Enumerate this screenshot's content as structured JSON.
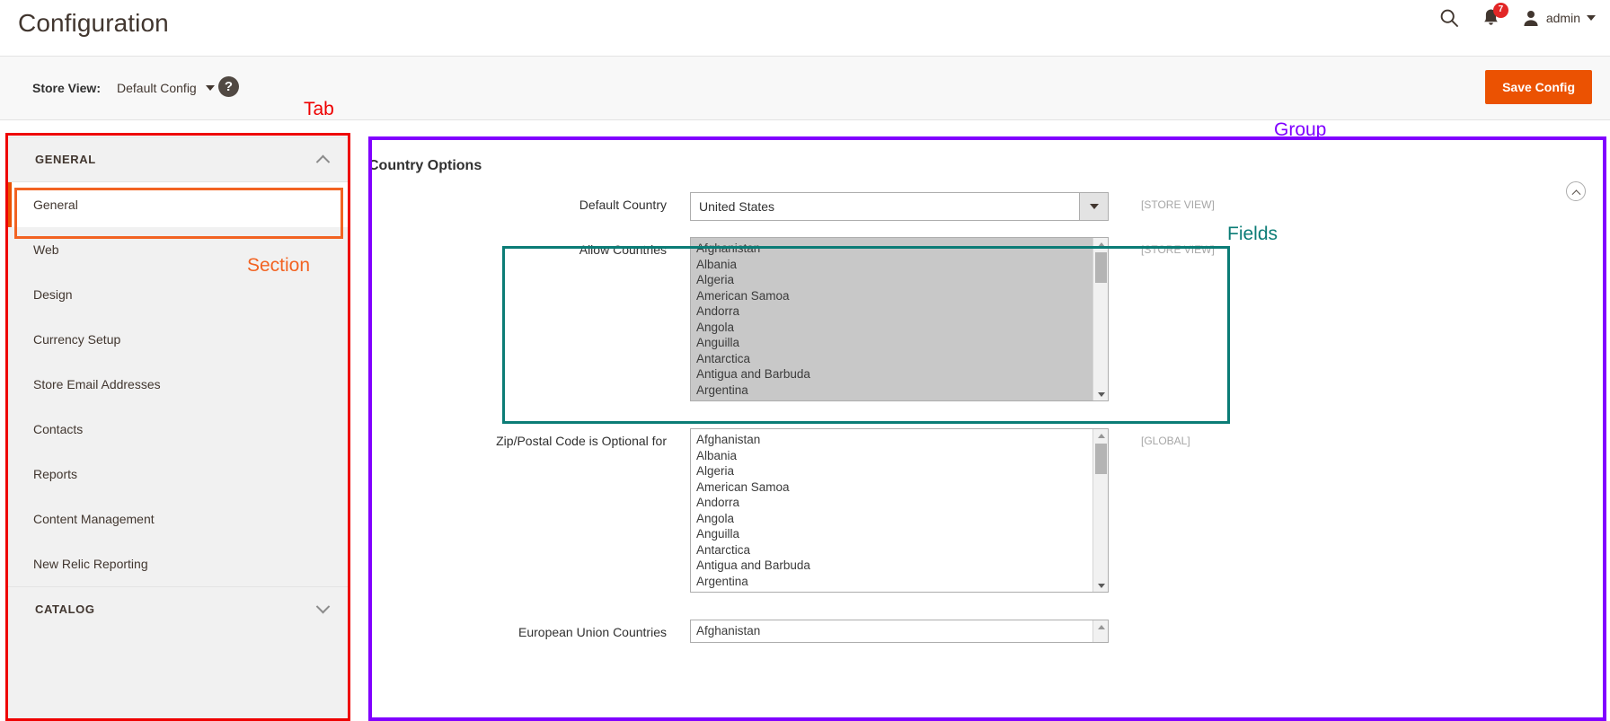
{
  "header": {
    "title": "Configuration",
    "search_icon": "search-icon",
    "notifications_icon": "bell-icon",
    "notifications_count": "7",
    "user_icon": "user-avatar-icon",
    "user_name": "admin",
    "caret_icon": "chevron-down-icon"
  },
  "switcher": {
    "label": "Store View:",
    "value": "Default Config",
    "caret_icon": "chevron-down-icon",
    "help_icon": "?",
    "save_label": "Save Config",
    "accent_color": "#eb5202"
  },
  "sidebar": {
    "groups": [
      {
        "title": "GENERAL",
        "chevron": "chevron-up-icon",
        "expanded": true,
        "items": [
          {
            "label": "General",
            "active": true
          },
          {
            "label": "Web",
            "active": false
          },
          {
            "label": "Design",
            "active": false
          },
          {
            "label": "Currency Setup",
            "active": false
          },
          {
            "label": "Store Email Addresses",
            "active": false
          },
          {
            "label": "Contacts",
            "active": false
          },
          {
            "label": "Reports",
            "active": false
          },
          {
            "label": "Content Management",
            "active": false
          },
          {
            "label": "New Relic Reporting",
            "active": false
          }
        ]
      },
      {
        "title": "CATALOG",
        "chevron": "chevron-down-icon",
        "expanded": false,
        "items": []
      }
    ]
  },
  "content": {
    "group_title": "Country Options",
    "collapse_icon": "chevron-up-circle-icon",
    "fields": [
      {
        "label": "Default Country",
        "type": "select",
        "value": "United States",
        "scope": "[STORE VIEW]"
      },
      {
        "label": "Allow Countries",
        "type": "multiselect",
        "selected": true,
        "scope": "[STORE VIEW]",
        "options": [
          "Afghanistan",
          "Albania",
          "Algeria",
          "American Samoa",
          "Andorra",
          "Angola",
          "Anguilla",
          "Antarctica",
          "Antigua and Barbuda",
          "Argentina"
        ]
      },
      {
        "label": "Zip/Postal Code is Optional for",
        "type": "multiselect",
        "selected": false,
        "scope": "[GLOBAL]",
        "options": [
          "Afghanistan",
          "Albania",
          "Algeria",
          "American Samoa",
          "Andorra",
          "Angola",
          "Anguilla",
          "Antarctica",
          "Antigua and Barbuda",
          "Argentina"
        ]
      },
      {
        "label": "European Union Countries",
        "type": "multiselect",
        "selected": false,
        "scope": "",
        "options": [
          "Afghanistan"
        ]
      }
    ]
  },
  "annotations": [
    {
      "text": "Tab",
      "color": "#ee0000"
    },
    {
      "text": "Section",
      "color": "#f26322"
    },
    {
      "text": "Group",
      "color": "#8000ff"
    },
    {
      "text": "Fields",
      "color": "#0b7c76"
    }
  ]
}
